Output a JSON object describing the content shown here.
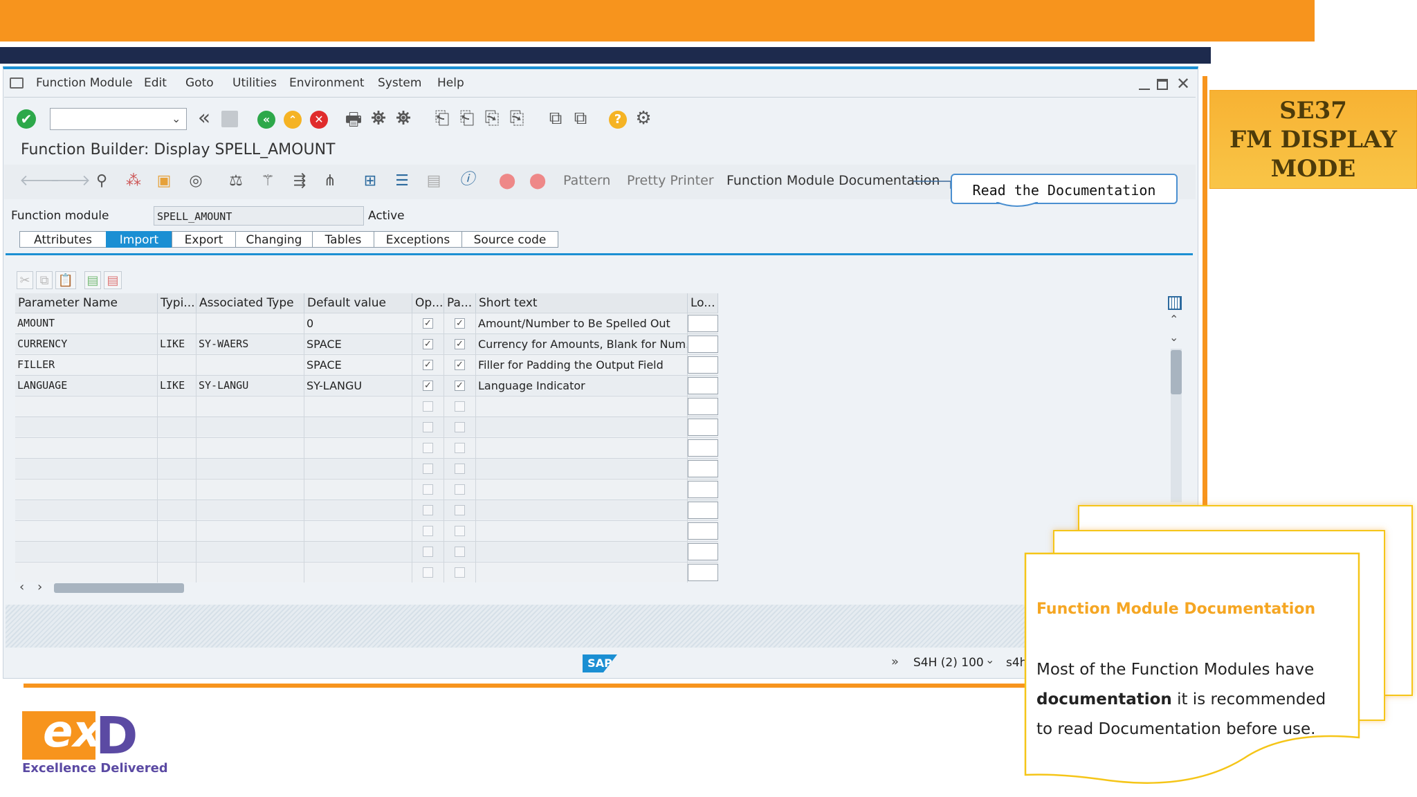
{
  "menubar": {
    "items": [
      "Function Module",
      "Edit",
      "Goto",
      "Utilities",
      "Environment",
      "System",
      "Help"
    ]
  },
  "title": "Function Builder: Display SPELL_AMOUNT",
  "app_toolbar": {
    "pattern": "Pattern",
    "pretty_printer": "Pretty Printer",
    "fm_documentation": "Function Module Documentation"
  },
  "callout": "Read the Documentation",
  "function_module": {
    "label": "Function module",
    "value": "SPELL_AMOUNT",
    "status": "Active"
  },
  "tabs": [
    "Attributes",
    "Import",
    "Export",
    "Changing",
    "Tables",
    "Exceptions",
    "Source code"
  ],
  "active_tab": "Import",
  "table": {
    "headers": [
      "Parameter Name",
      "Typi...",
      "Associated Type",
      "Default value",
      "Op...",
      "Pa...",
      "Short text",
      "Lo..."
    ],
    "rows": [
      {
        "name": "AMOUNT",
        "typing": "",
        "assoc": "",
        "default": "0",
        "optional": true,
        "pass": true,
        "short": "Amount/Number to Be Spelled Out"
      },
      {
        "name": "CURRENCY",
        "typing": "LIKE",
        "assoc": "SY-WAERS",
        "default": "SPACE",
        "optional": true,
        "pass": true,
        "short": "Currency for Amounts, Blank for Num..."
      },
      {
        "name": "FILLER",
        "typing": "",
        "assoc": "",
        "default": "SPACE",
        "optional": true,
        "pass": true,
        "short": "Filler for Padding the Output Field"
      },
      {
        "name": "LANGUAGE",
        "typing": "LIKE",
        "assoc": "SY-LANGU",
        "default": "SY-LANGU",
        "optional": true,
        "pass": true,
        "short": "Language Indicator"
      }
    ],
    "empty_rows": 9
  },
  "statusbar": {
    "system": "S4H (2) 100",
    "client": "s4h",
    "logo": "SAP"
  },
  "side_title": {
    "line1": "SE37",
    "line2": "FM DISPLAY",
    "line3": "MODE"
  },
  "note": {
    "heading": "Function Module Documentation",
    "text_before": "Most of the Function Modules have",
    "bold": "documentation",
    "text_after": " it is recommended to read Documentation before use."
  },
  "brand": {
    "logo_e": "ex",
    "logo_d": "D",
    "tagline": "Excellence Delivered"
  },
  "colors": {
    "orange": "#f7941d",
    "navy": "#1d2a4d",
    "sap_blue": "#1b8fd3",
    "note_heading": "#f5a623",
    "brand_purple": "#5b4aa3"
  }
}
